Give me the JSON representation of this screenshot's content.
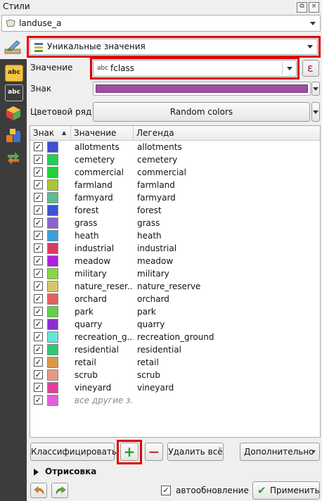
{
  "panel": {
    "title": "Стили"
  },
  "layer": {
    "name": "landuse_a"
  },
  "renderer": {
    "selected": "Уникальные значения"
  },
  "value_field": {
    "label": "Значение",
    "type_badge": "abc",
    "value": "fclass",
    "expr_icon": "ε"
  },
  "symbol": {
    "label": "Знак",
    "color": "#9b4fa0"
  },
  "color_ramp": {
    "label": "Цветовой ряд",
    "value": "Random colors"
  },
  "table": {
    "headers": {
      "symbol": "Знак",
      "value": "Значение",
      "legend": "Легенда"
    },
    "rows": [
      {
        "value": "allotments",
        "legend": "allotments",
        "color": "#3c4fd8"
      },
      {
        "value": "cemetery",
        "legend": "cemetery",
        "color": "#1fcf58"
      },
      {
        "value": "commercial",
        "legend": "commercial",
        "color": "#23d13c"
      },
      {
        "value": "farmland",
        "legend": "farmland",
        "color": "#a9c634"
      },
      {
        "value": "farmyard",
        "legend": "farmyard",
        "color": "#5ebd94"
      },
      {
        "value": "forest",
        "legend": "forest",
        "color": "#3a55cf"
      },
      {
        "value": "grass",
        "legend": "grass",
        "color": "#8a63cf"
      },
      {
        "value": "heath",
        "legend": "heath",
        "color": "#3c9fdc"
      },
      {
        "value": "industrial",
        "legend": "industrial",
        "color": "#d63b66"
      },
      {
        "value": "meadow",
        "legend": "meadow",
        "color": "#b21ee0"
      },
      {
        "value": "military",
        "legend": "military",
        "color": "#88d83e"
      },
      {
        "value": "nature_reser...",
        "legend": "nature_reserve",
        "color": "#d8c46c"
      },
      {
        "value": "orchard",
        "legend": "orchard",
        "color": "#e45f5f"
      },
      {
        "value": "park",
        "legend": "park",
        "color": "#62cf4b"
      },
      {
        "value": "quarry",
        "legend": "quarry",
        "color": "#8d2fd0"
      },
      {
        "value": "recreation_g...",
        "legend": "recreation_ground",
        "color": "#66e6d6"
      },
      {
        "value": "residential",
        "legend": "residential",
        "color": "#2fc774"
      },
      {
        "value": "retail",
        "legend": "retail",
        "color": "#d89a4a"
      },
      {
        "value": "scrub",
        "legend": "scrub",
        "color": "#e69a82"
      },
      {
        "value": "vineyard",
        "legend": "vineyard",
        "color": "#e23f9c"
      },
      {
        "value": "все другие з...",
        "legend": "",
        "color": "#e45fd8",
        "other": true
      }
    ]
  },
  "buttons": {
    "classify": "Классифицировать",
    "add": "+",
    "remove": "−",
    "delete_all": "Удалить всё",
    "advanced": "Дополнительно",
    "apply": "Применить"
  },
  "rendering": {
    "label": "Отрисовка"
  },
  "auto_update": {
    "label": "автообновление",
    "checked": true
  }
}
